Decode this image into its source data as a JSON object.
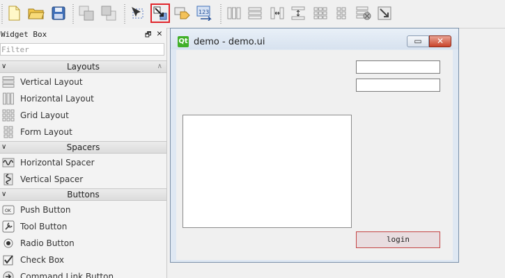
{
  "widget_box": {
    "title": "Widget Box",
    "float_glyph": "🗗",
    "close_glyph": "✕",
    "filter_placeholder": "Filter",
    "categories": [
      {
        "label": "Layouts",
        "items": [
          "Vertical Layout",
          "Horizontal Layout",
          "Grid Layout",
          "Form Layout"
        ]
      },
      {
        "label": "Spacers",
        "items": [
          "Horizontal Spacer",
          "Vertical Spacer"
        ]
      },
      {
        "label": "Buttons",
        "items": [
          "Push Button",
          "Tool Button",
          "Radio Button",
          "Check Box",
          "Command Link Button"
        ]
      }
    ]
  },
  "push_button_icon_text": "OK",
  "form_window": {
    "logo_text": "Qt",
    "title": "demo - demo.ui",
    "minimize_glyph": "▭",
    "close_glyph": "✕",
    "login_label": "login"
  },
  "toolbar": {
    "selected_tool": "edit-buddies",
    "spacer_icon_text": "123"
  },
  "colors": {
    "selection_red": "#e0242a",
    "qt_green": "#41b028",
    "close_red": "#c9432b"
  }
}
